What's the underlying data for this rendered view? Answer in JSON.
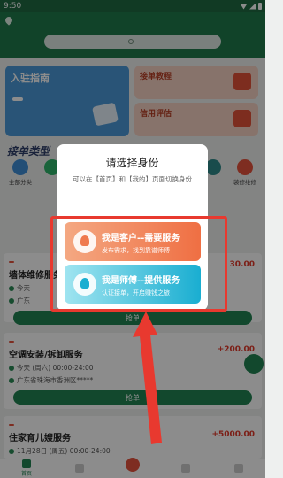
{
  "status_bar": {
    "time": "9:50"
  },
  "header": {
    "location": "",
    "search_placeholder": ""
  },
  "banner": {
    "title": "入驻指南",
    "button": ""
  },
  "cards": [
    {
      "title": "接单教程",
      "sub": ""
    },
    {
      "title": "信用评估",
      "sub": ""
    }
  ],
  "section": {
    "title": "接单类型",
    "hint": ""
  },
  "categories": [
    {
      "label": "全部分类",
      "color": "#3f8fd8"
    },
    {
      "label": "",
      "color": "#2fb56a"
    },
    {
      "label": "",
      "color": "#f0a43a"
    },
    {
      "label": "",
      "color": "#e5533c"
    },
    {
      "label": "",
      "color": "#3fb4c8"
    },
    {
      "label": "",
      "color": "#9a6ad8"
    },
    {
      "label": "",
      "color": "#2f8a8a"
    },
    {
      "label": "装修维修",
      "color": "#e5533c"
    }
  ],
  "orders": [
    {
      "tag": "",
      "title": "墙体维修服务",
      "price": "30.00",
      "date": "今天",
      "address": "广东",
      "grab": "抢单"
    },
    {
      "tag": "",
      "title": "空调安装/拆卸服务",
      "price": "+200.00",
      "date": "今天 (周六) 00:00-24:00",
      "address": "广东省珠海市香洲区*****",
      "grab": "抢单"
    },
    {
      "tag": "",
      "title": "住家育儿嫂服务",
      "price": "+5000.00",
      "date": "11月28日 (周五) 00:00-24:00",
      "address": "",
      "grab": ""
    }
  ],
  "tabs": [
    {
      "label": "首页"
    },
    {
      "label": ""
    },
    {
      "label": ""
    },
    {
      "label": ""
    },
    {
      "label": ""
    }
  ],
  "modal": {
    "title": "请选择身份",
    "subtitle": "可以在【首页】和【我的】页面切换身份",
    "options": [
      {
        "title": "我是客户--需要服务",
        "desc": "发布需求，找到靠谱师傅"
      },
      {
        "title": "我是师傅--提供服务",
        "desc": "认证接单，开启赚钱之旅"
      }
    ]
  },
  "colors": {
    "brand": "#228452",
    "highlight": "#e8392f",
    "customer": "#ef6f43",
    "worker": "#1aaed1"
  }
}
